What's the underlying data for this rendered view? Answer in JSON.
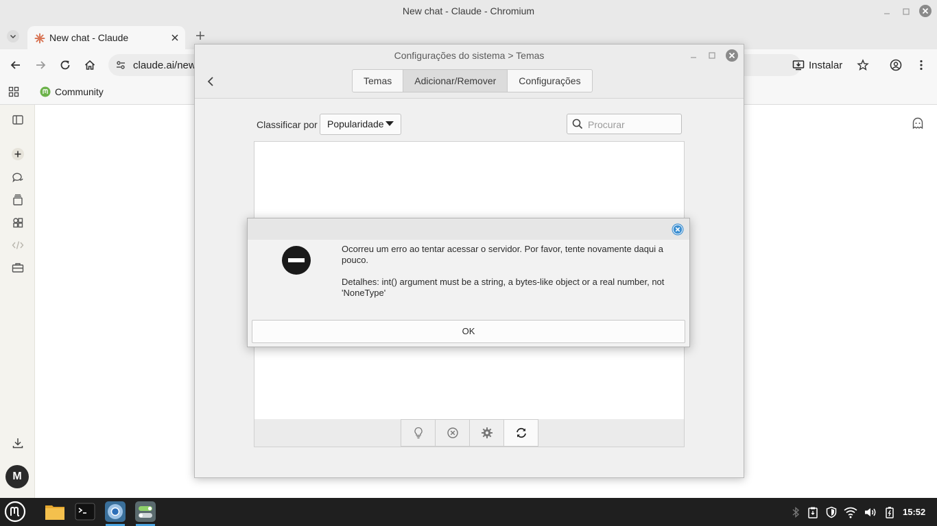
{
  "window": {
    "title": "New chat - Claude - Chromium"
  },
  "browser": {
    "tab": {
      "title": "New chat - Claude"
    },
    "url": "claude.ai/new",
    "install_label": "Instalar",
    "bookmarks": [
      {
        "label": "Community"
      }
    ]
  },
  "claude": {
    "sidebar_icons": [
      "sidebar-toggle-icon",
      "new-chat-icon",
      "chats-icon",
      "projects-icon",
      "artifacts-icon",
      "code-icon",
      "briefcase-icon",
      "download-icon"
    ],
    "avatar_letter": "M"
  },
  "settings": {
    "title": "Configurações do sistema > Temas",
    "tabs": [
      {
        "label": "Temas",
        "active": false
      },
      {
        "label": "Adicionar/Remover",
        "active": true
      },
      {
        "label": "Configurações",
        "active": false
      }
    ],
    "sort_label": "Classificar por",
    "sort_value": "Popularidade",
    "search_placeholder": "Procurar",
    "toolbar_icons": [
      "lightbulb-icon",
      "remove-icon",
      "gear-icon",
      "refresh-icon"
    ]
  },
  "dialog": {
    "icon": "error-stop-icon",
    "message": "Ocorreu um erro ao tentar acessar o servidor. Por favor, tente novamente daqui a pouco.",
    "details": "Detalhes: int() argument must be a string, a bytes-like object or a real number, not 'NoneType'",
    "ok_label": "OK"
  },
  "taskbar": {
    "apps": [
      "mint-menu-icon",
      "files-icon",
      "terminal-icon",
      "chromium-icon",
      "settings-app-icon"
    ],
    "tray": [
      "bluetooth-icon",
      "clipboard-icon",
      "shield-icon",
      "wifi-icon",
      "volume-icon",
      "battery-icon"
    ],
    "time": "15:52"
  },
  "colors": {
    "accent": "#4aa3df",
    "claude_orange": "#d97757",
    "mint_green": "#6cb24a"
  }
}
